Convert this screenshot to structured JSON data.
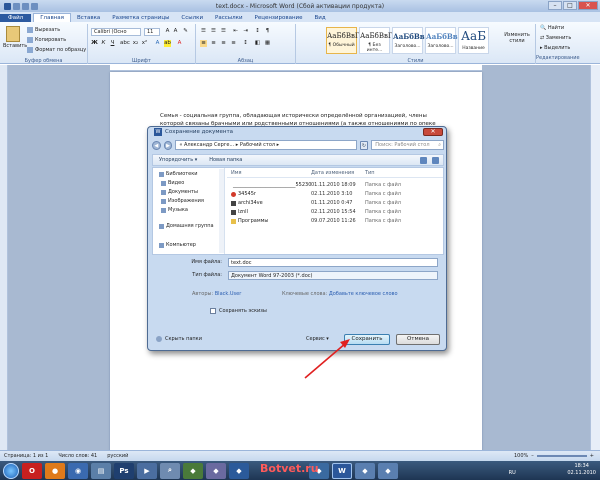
{
  "window": {
    "title": "text.docx - Microsoft Word (Сбой активации продукта)"
  },
  "tabs": [
    {
      "label": "Файл"
    },
    {
      "label": "Главная"
    },
    {
      "label": "Вставка"
    },
    {
      "label": "Разметка страницы"
    },
    {
      "label": "Ссылки"
    },
    {
      "label": "Рассылки"
    },
    {
      "label": "Рецензирование"
    },
    {
      "label": "Вид"
    }
  ],
  "ribbon": {
    "clipboard": {
      "paste": "Вставить",
      "cut": "Вырезать",
      "copy": "Копировать",
      "format": "Формат по образцу",
      "label": "Буфер обмена"
    },
    "font": {
      "name": "Calibri (Осно",
      "size": "11",
      "label": "Шрифт"
    },
    "paragraph": {
      "label": "Абзац"
    },
    "styles": {
      "label": "Стили",
      "items": [
        {
          "sample": "АаБбВвГг,",
          "name": "¶ Обычный"
        },
        {
          "sample": "АаБбВвГг,",
          "name": "¶ Без инте..."
        },
        {
          "sample": "АаБбВв",
          "name": "Заголово..."
        },
        {
          "sample": "АаБбВв",
          "name": "Заголово..."
        },
        {
          "sample": "АаБ",
          "name": "Название"
        }
      ],
      "change": "Изменить стили"
    },
    "editing": {
      "find": "Найти",
      "replace": "Заменить",
      "select": "Выделить",
      "label": "Редактирование"
    }
  },
  "document": {
    "text": "Семья - социальная группа, обладающая исторически определённой организацией, члены которой связаны брачными или родственными отношениями (а также отношениями по опеке"
  },
  "dialog": {
    "title": "Сохранение документа",
    "path": "« Александр Серге... ▸ Рабочий стол ▸",
    "search_placeholder": "Поиск: Рабочий стол",
    "organize": "Упорядочить ▾",
    "new_folder": "Новая папка",
    "nav": [
      {
        "label": "Библиотеки"
      },
      {
        "label": "Видео"
      },
      {
        "label": "Документы"
      },
      {
        "label": "Изображения"
      },
      {
        "label": "Музыка"
      },
      {
        "label": "Домашняя группа"
      },
      {
        "label": "Компьютер"
      }
    ],
    "columns": {
      "name": "Имя",
      "date": "Дата изменения",
      "type": "Тип"
    },
    "files": [
      {
        "name": "_________________________55230",
        "date": "01.11.2010 18:09",
        "type": "Папка с файл"
      },
      {
        "name": "34545r",
        "date": "02.11.2010 3:10",
        "type": "Папка с файл"
      },
      {
        "name": "archi34ve",
        "date": "01.11.2010 0:47",
        "type": "Папка с файл"
      },
      {
        "name": "lznll",
        "date": "02.11.2010 15:54",
        "type": "Папка с файл"
      },
      {
        "name": "Программы",
        "date": "09.07.2010 11:26",
        "type": "Папка с файл"
      }
    ],
    "filename_label": "Имя файла:",
    "filename": "text.doc",
    "filetype_label": "Тип файла:",
    "filetype": "Документ Word 97-2003 (*.doc)",
    "authors_label": "Авторы:",
    "authors": "Black.User",
    "keywords_label": "Ключевые слова:",
    "keywords": "Добавьте ключевое слово",
    "thumbs": "Сохранять эскизы",
    "hide": "Скрыть папки",
    "service": "Сервис ▾",
    "save": "Сохранить",
    "cancel": "Отмена"
  },
  "status": {
    "page": "Страница: 1 из 1",
    "words": "Число слов: 41",
    "lang": "русский",
    "zoom": "100%"
  },
  "taskbar": {
    "lang": "RU",
    "time": "18:34",
    "date": "02.11.2010"
  },
  "watermark": "Botvet.ru"
}
